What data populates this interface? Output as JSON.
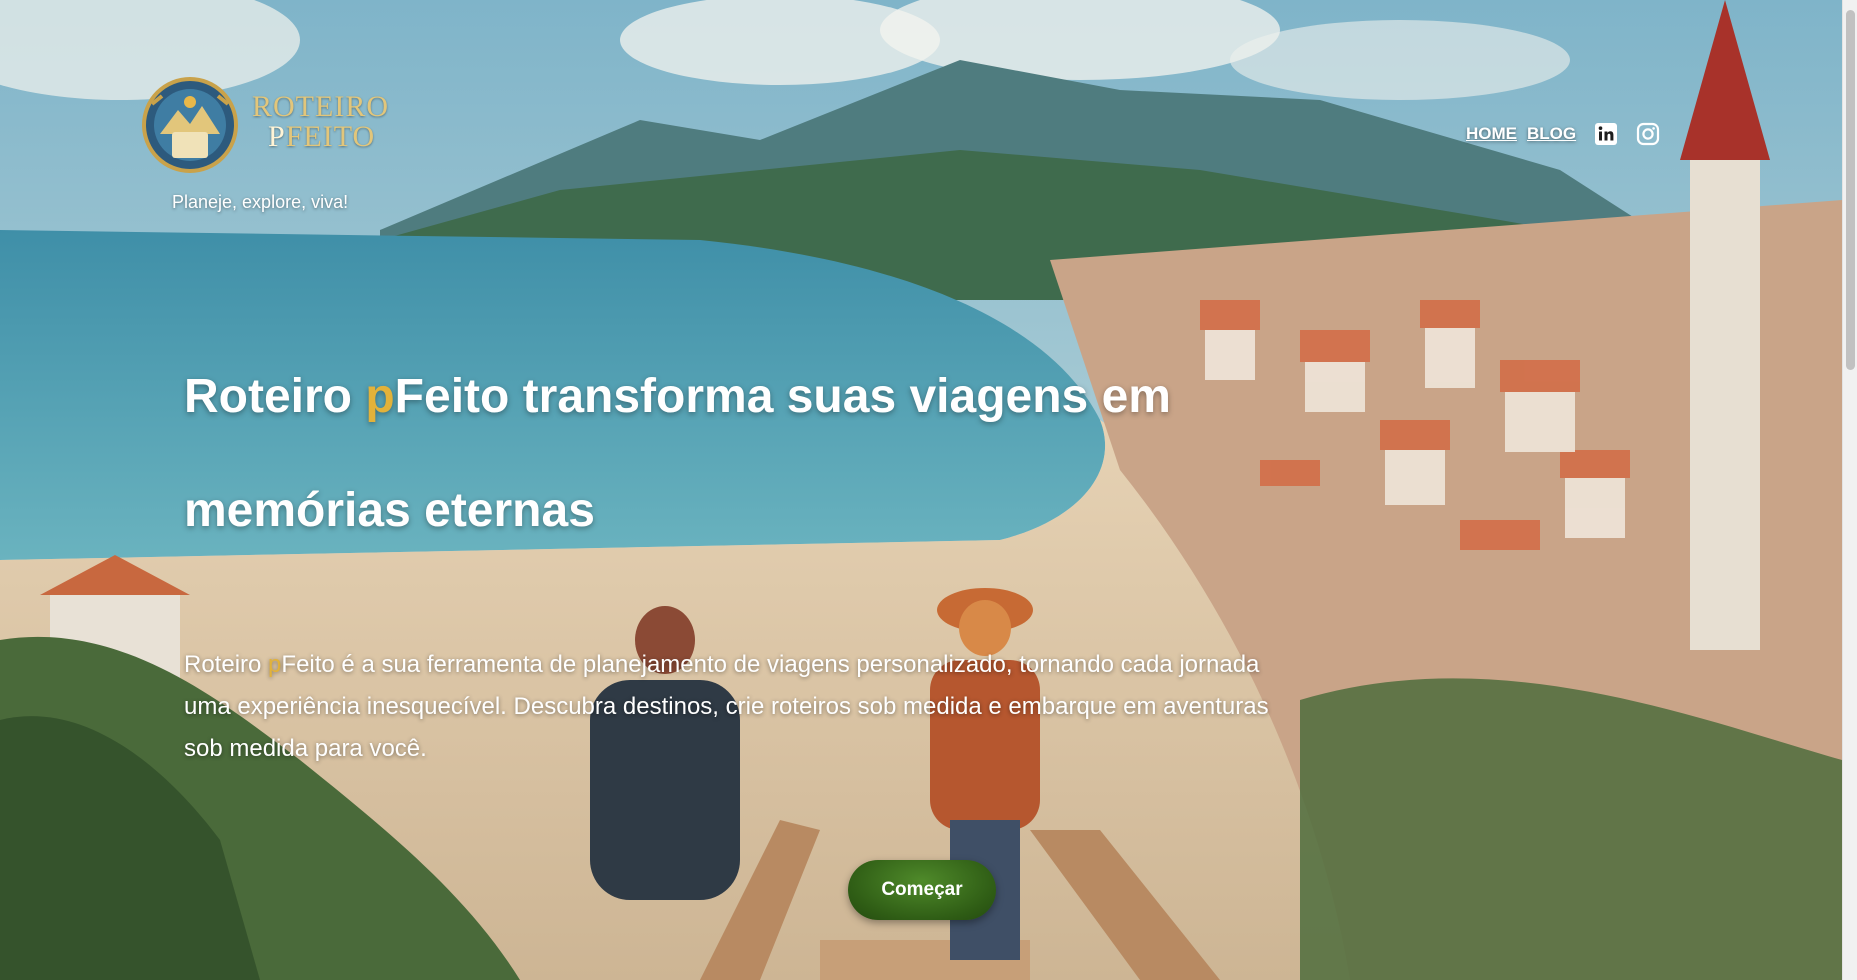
{
  "brand": {
    "logo_line1": "ROTEIRO",
    "logo_line2_first": "P",
    "logo_line2_rest": "FEITO",
    "tagline": "Planeje, explore, viva!"
  },
  "nav": {
    "home": "HOME",
    "blog": "BLOG"
  },
  "hero": {
    "title_part1": "Roteiro ",
    "title_highlight": "p",
    "title_part2": "Feito transforma suas viagens em memórias eternas",
    "text_part1": "Roteiro ",
    "text_highlight": "p",
    "text_part2": "Feito é a sua ferramenta de planejamento de viagens personalizado, tornando cada jornada uma experiência inesquecível. Descubra destinos, crie roteiros sob medida e embarque em aventuras sob medida para você.",
    "cta_label": "Começar"
  },
  "icons": {
    "linkedin": "linkedin-icon",
    "instagram": "instagram-icon"
  },
  "colors": {
    "highlight": "#e2b23a",
    "cta": "#3a6b1c"
  }
}
